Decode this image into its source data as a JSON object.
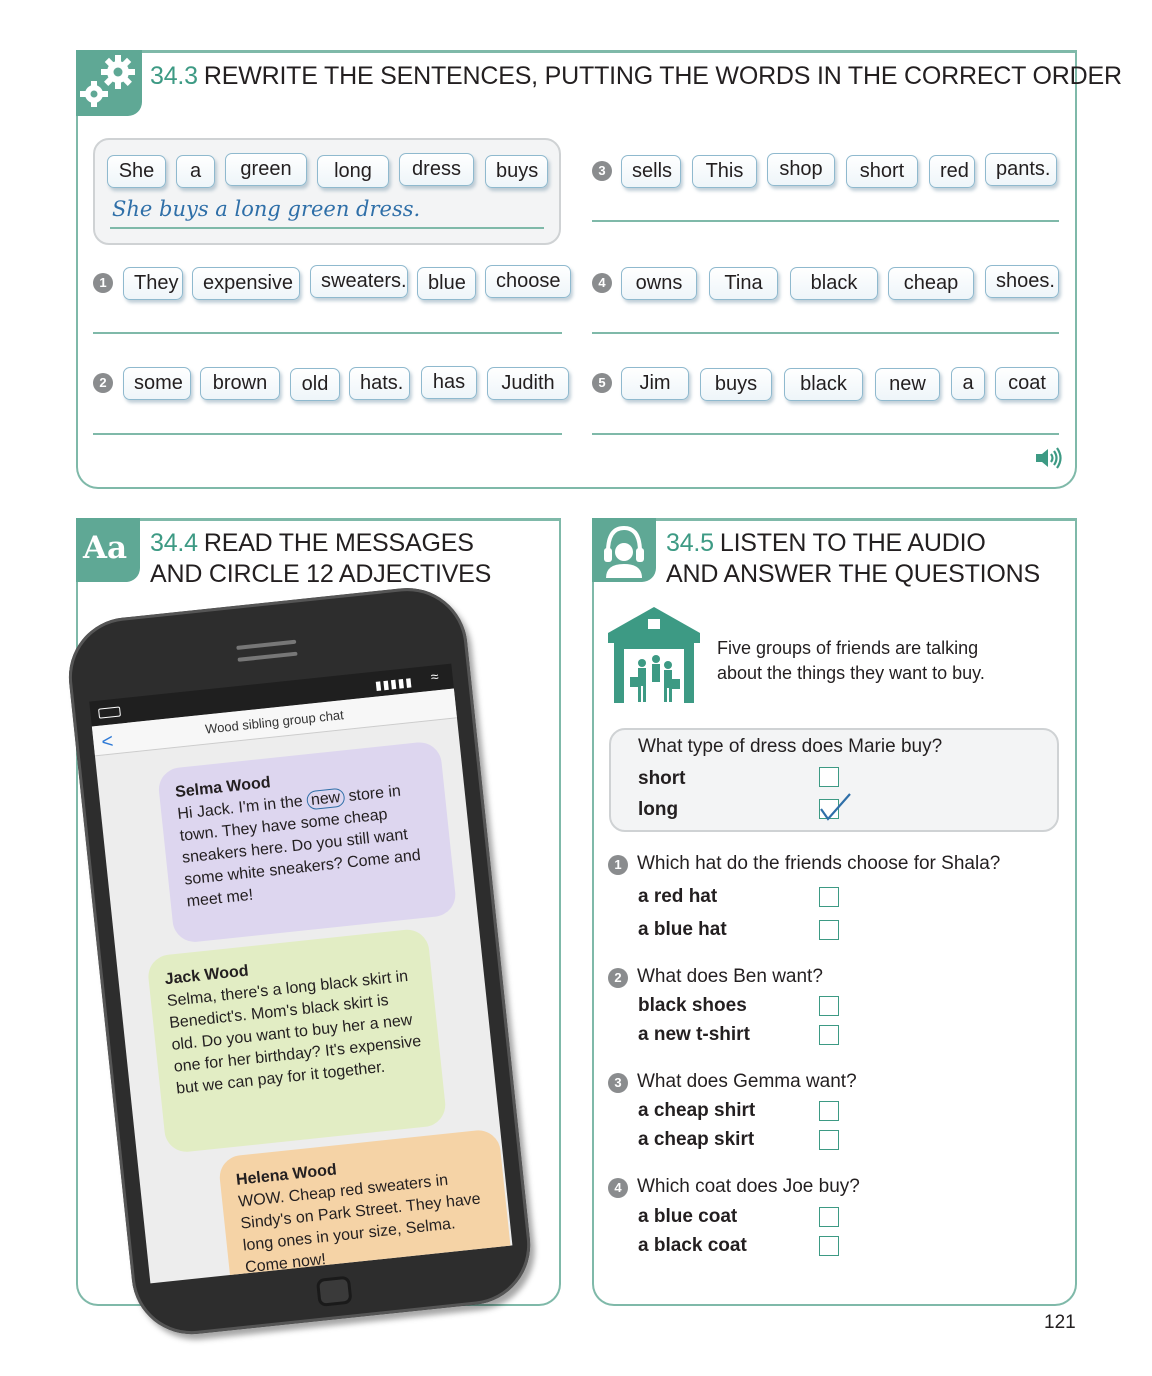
{
  "section_343": {
    "number": "34.3",
    "title": "REWRITE THE SENTENCES, PUTTING THE WORDS IN THE CORRECT ORDER",
    "example_words": [
      "She",
      "a",
      "green",
      "long",
      "dress",
      "buys"
    ],
    "example_answer": "She buys a long green dress.",
    "items": [
      {
        "num": "1",
        "words": [
          "They",
          "expensive",
          "sweaters.",
          "blue",
          "choose"
        ]
      },
      {
        "num": "2",
        "words": [
          "some",
          "brown",
          "old",
          "hats.",
          "has",
          "Judith"
        ]
      },
      {
        "num": "3",
        "words": [
          "sells",
          "This",
          "shop",
          "short",
          "red",
          "pants."
        ]
      },
      {
        "num": "4",
        "words": [
          "owns",
          "Tina",
          "black",
          "cheap",
          "shoes."
        ]
      },
      {
        "num": "5",
        "words": [
          "Jim",
          "buys",
          "black",
          "new",
          "a",
          "coat"
        ]
      }
    ],
    "audio_icon": "speaker-icon"
  },
  "section_344": {
    "tab_label": "Aa",
    "number": "34.4",
    "title_line1": "READ THE MESSAGES",
    "title_line2": "AND CIRCLE 12 ADJECTIVES",
    "chat_title": "Wood sibling group chat",
    "back_glyph": "<",
    "messages": [
      {
        "name": "Selma Wood",
        "text_before": "Hi Jack. I'm in the ",
        "circled": "new",
        "text_after": " store in town. They have some cheap sneakers here. Do you still want some white sneakers? Come and meet me!",
        "color": "#ddd6ef"
      },
      {
        "name": "Jack Wood",
        "text": "Selma, there's a long black skirt in Benedict's. Mom's black skirt is old. Do you want to buy her a new one for her birthday? It's expensive but we can pay for it together.",
        "color": "#e2edc4"
      },
      {
        "name": "Helena Wood",
        "text": "WOW. Cheap red sweaters in Sindy's on Park Street. They have long ones in your size, Selma. Come now!",
        "color": "#f5d3a6"
      }
    ]
  },
  "section_345": {
    "number": "34.5",
    "title_line1": "LISTEN TO THE AUDIO",
    "title_line2": "AND ANSWER THE QUESTIONS",
    "intro": "Five groups of friends are talking about the things they want to buy.",
    "example": {
      "question": "What type of dress does Marie buy?",
      "options": [
        "short",
        "long"
      ],
      "checked": 1
    },
    "questions": [
      {
        "num": "1",
        "question": "Which hat do the friends choose for Shala?",
        "options": [
          "a red hat",
          "a blue hat"
        ]
      },
      {
        "num": "2",
        "question": "What does Ben want?",
        "options": [
          "black shoes",
          "a new t-shirt"
        ]
      },
      {
        "num": "3",
        "question": "What does Gemma want?",
        "options": [
          "a cheap shirt",
          "a cheap skirt"
        ]
      },
      {
        "num": "4",
        "question": "Which coat does Joe buy?",
        "options": [
          "a blue coat",
          "a black coat"
        ]
      }
    ]
  },
  "page_number": "121",
  "colors": {
    "accent": "#5fa895",
    "accent_text": "#3d9a84",
    "panel_border": "#7fb9a9",
    "handwriting": "#2f6fa8"
  }
}
